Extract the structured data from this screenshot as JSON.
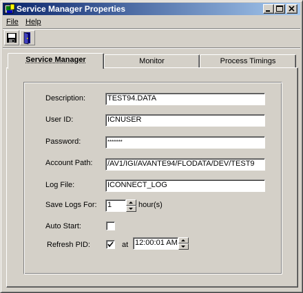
{
  "window": {
    "title": "Service Manager Properties",
    "controls": [
      "minimize-icon",
      "maximize-icon",
      "close-icon"
    ]
  },
  "menu": {
    "file": "File",
    "help": "Help"
  },
  "toolbar": {
    "buttons": [
      "save-icon",
      "exit-door-icon"
    ]
  },
  "tabs": [
    {
      "label": "Service Manager",
      "active": true
    },
    {
      "label": "Monitor",
      "active": false
    },
    {
      "label": "Process Timings",
      "active": false
    }
  ],
  "form": {
    "description_label": "Description:",
    "description_value": "TEST94.DATA",
    "userid_label": "User ID:",
    "userid_value": "ICNUSER",
    "password_label": "Password:",
    "password_value": "*******",
    "account_path_label": "Account Path:",
    "account_path_value": "/AV1/IGI/AVANTE94/FLODATA/DEV/TEST9",
    "log_file_label": "Log File:",
    "log_file_value": "ICONNECT_LOG",
    "save_logs_label": "Save Logs For:",
    "save_logs_value": "1",
    "save_logs_unit": "hour(s)",
    "auto_start_label": "Auto Start:",
    "auto_start_checked": false,
    "refresh_pid_label": "Refresh  PID:",
    "refresh_pid_checked": true,
    "refresh_at_label": "at",
    "refresh_time_value": "12:00:01 AM"
  },
  "colors": {
    "title_gradient_start": "#0a246a",
    "title_gradient_end": "#a6caf0",
    "face": "#d4d0c8"
  }
}
